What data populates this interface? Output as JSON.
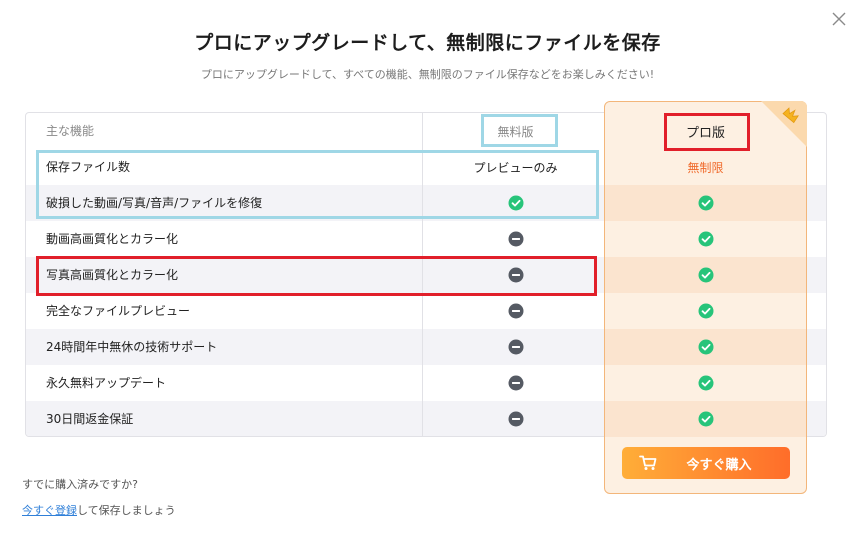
{
  "dialog": {
    "title": "プロにアップグレードして、無制限にファイルを保存",
    "subtitle": "プロにアップグレードして、すべての機能、無制限のファイル保存などをお楽しみください!"
  },
  "table": {
    "header": {
      "feature_label": "主な機能",
      "free_label": "無料版",
      "pro_label": "プロ版"
    },
    "rows": [
      {
        "feature": "保存ファイル数",
        "free": "プレビューのみ",
        "pro": "無制限"
      },
      {
        "feature": "破損した動画/写真/音声/ファイルを修復",
        "free_icon": "check-icon",
        "pro_icon": "check-icon"
      },
      {
        "feature": "動画高画質化とカラー化",
        "free_icon": "minus-icon",
        "pro_icon": "check-icon"
      },
      {
        "feature": "写真高画質化とカラー化",
        "free_icon": "minus-icon",
        "pro_icon": "check-icon"
      },
      {
        "feature": "完全なファイルプレビュー",
        "free_icon": "minus-icon",
        "pro_icon": "check-icon"
      },
      {
        "feature": "24時間年中無休の技術サポート",
        "free_icon": "minus-icon",
        "pro_icon": "check-icon"
      },
      {
        "feature": "永久無料アップデート",
        "free_icon": "minus-icon",
        "pro_icon": "check-icon"
      },
      {
        "feature": "30日間返金保証",
        "free_icon": "minus-icon",
        "pro_icon": "check-icon"
      }
    ]
  },
  "buy_button": {
    "label": "今すぐ購入",
    "icon": "cart-icon"
  },
  "footer": {
    "already_purchased": "すでに購入済みですか?",
    "register_link": "今すぐ登録",
    "register_suffix": "して保存しましょう"
  },
  "colors": {
    "accent_orange": "#f06a2b",
    "check_green": "#27c47a",
    "minus_gray": "#555a63",
    "highlight_blue": "#9fd7e6",
    "highlight_red": "#e11f2a"
  }
}
